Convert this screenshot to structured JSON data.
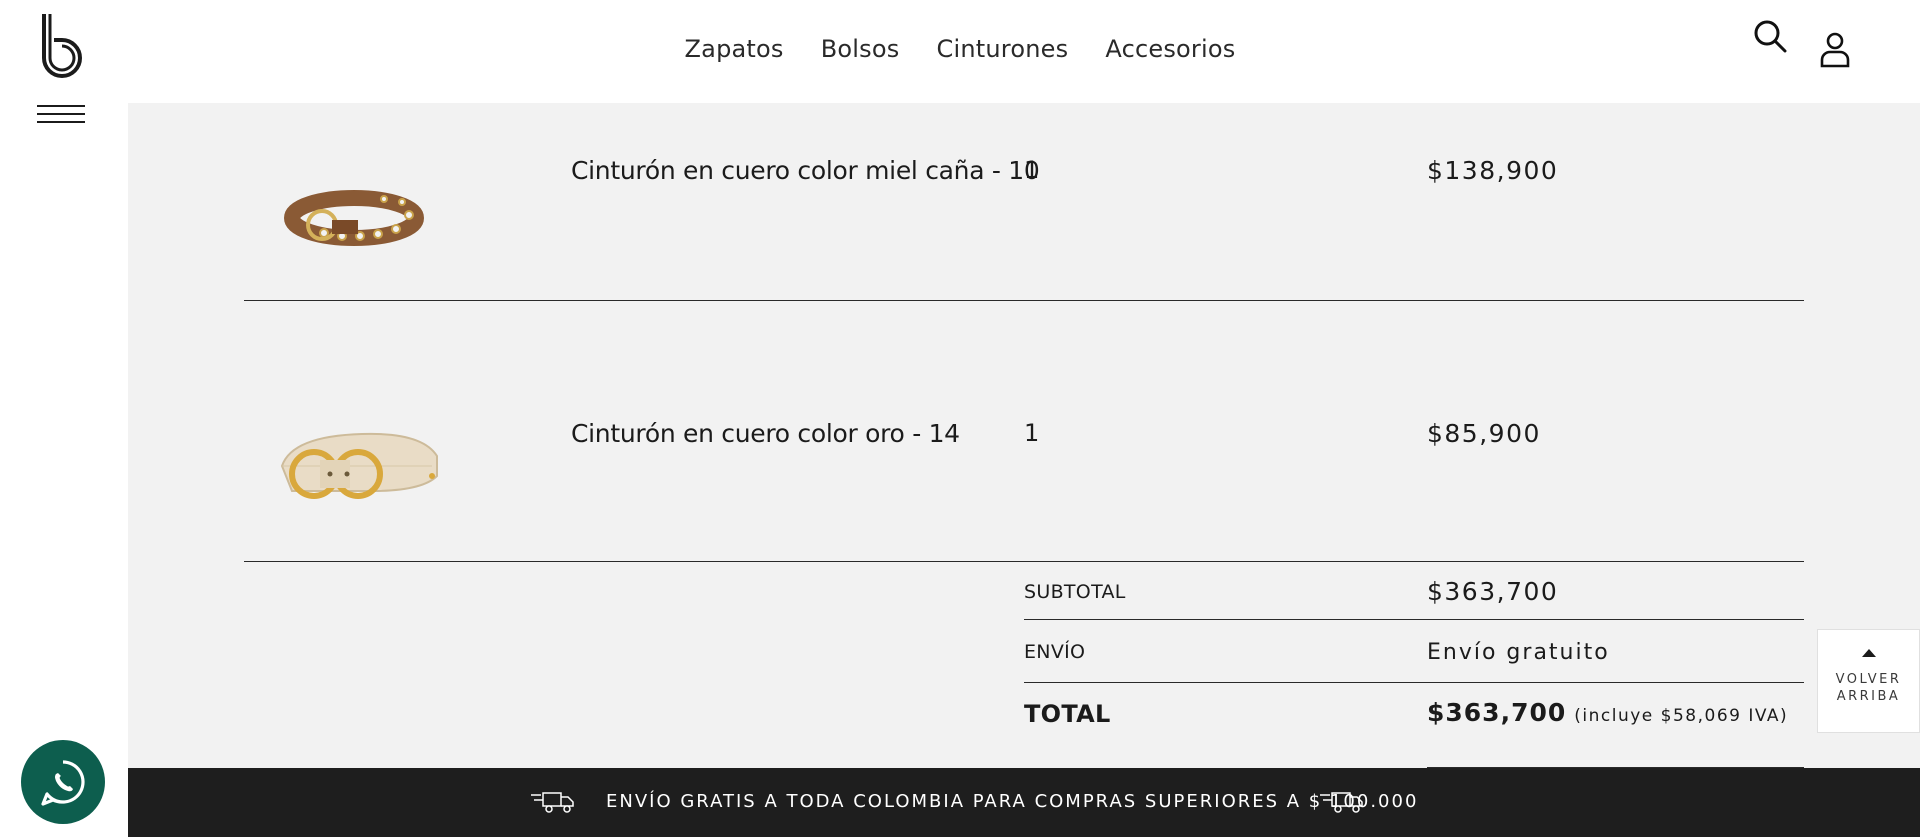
{
  "header": {
    "nav": [
      {
        "label": "Zapatos"
      },
      {
        "label": "Bolsos"
      },
      {
        "label": "Cinturones"
      },
      {
        "label": "Accesorios"
      }
    ]
  },
  "cart": {
    "items": [
      {
        "name": "Cinturón en cuero color miel caña - 10",
        "qty": "1",
        "price": "$138,900",
        "image": "brown-belt-with-grommets"
      },
      {
        "name": "Cinturón en cuero color oro - 14",
        "qty": "1",
        "price": "$85,900",
        "image": "gold-belt-with-double-ring-buckle"
      }
    ],
    "summary": {
      "subtotal_label": "SUBTOTAL",
      "subtotal_value": "$363,700",
      "shipping_label": "ENVÍO",
      "shipping_value": "Envío gratuito",
      "total_label": "TOTAL",
      "total_value": "$363,700",
      "total_iva": "(incluye $58,069 IVA)"
    }
  },
  "back_to_top": {
    "line1": "VOLVER",
    "line2": "ARRIBA"
  },
  "banner": {
    "text": "ENVÍO GRATIS A TODA COLOMBIA PARA COMPRAS SUPERIORES A $ 100.000"
  },
  "icons": [
    "brand-logo-icon",
    "menu-icon",
    "search-icon",
    "user-icon",
    "truck-icon",
    "whatsapp-icon",
    "arrow-up-icon"
  ],
  "colors": {
    "background_gray": "#f2f2f2",
    "banner": "#1e1e1e",
    "whatsapp": "#0d5e4e",
    "text": "#1b1b1b"
  }
}
